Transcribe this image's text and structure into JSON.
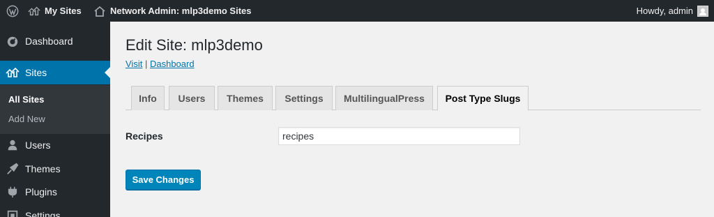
{
  "adminbar": {
    "my_sites": "My Sites",
    "network_admin": "Network Admin: mlp3demo Sites",
    "howdy": "Howdy, admin",
    "icons": [
      "wordpress-icon",
      "my-sites-icon",
      "home-icon",
      "avatar"
    ]
  },
  "sidebar": {
    "items": [
      {
        "label": "Dashboard",
        "icon": "dashboard-icon"
      },
      {
        "label": "Sites",
        "icon": "sites-icon"
      },
      {
        "label": "Users",
        "icon": "users-icon"
      },
      {
        "label": "Themes",
        "icon": "themes-icon"
      },
      {
        "label": "Plugins",
        "icon": "plugins-icon"
      },
      {
        "label": "Settings",
        "icon": "settings-icon"
      }
    ],
    "submenu": [
      {
        "label": "All Sites"
      },
      {
        "label": "Add New"
      }
    ]
  },
  "main": {
    "title": "Edit Site: mlp3demo",
    "visit": "Visit",
    "separator": "|",
    "dashboard": "Dashboard",
    "tabs": [
      {
        "label": "Info"
      },
      {
        "label": "Users"
      },
      {
        "label": "Themes"
      },
      {
        "label": "Settings"
      },
      {
        "label": "MultilingualPress"
      },
      {
        "label": "Post Type Slugs"
      }
    ],
    "active_tab": "Post Type Slugs",
    "field": {
      "label": "Recipes",
      "value": "recipes"
    },
    "save_label": "Save Changes"
  },
  "colors": {
    "adminbar_bg": "#23282d",
    "sidebar_bg": "#23282d",
    "accent": "#0073aa",
    "button": "#0085ba",
    "content_bg": "#f1f1f1"
  }
}
